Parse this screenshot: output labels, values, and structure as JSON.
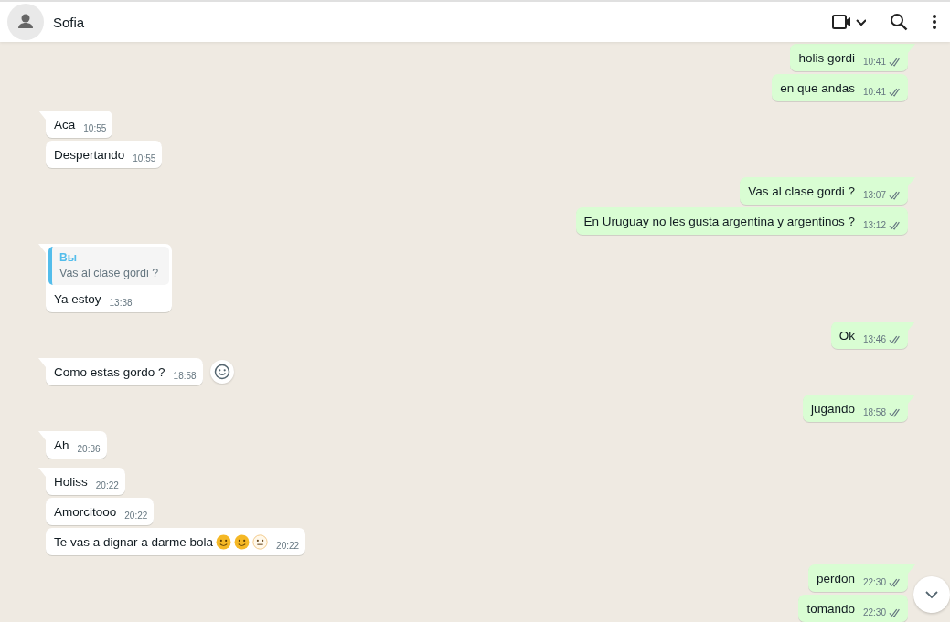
{
  "contact": {
    "name": "Sofia"
  },
  "messages": [
    {
      "outgoing": true,
      "kind": "text",
      "tail": true,
      "text": "holis gordi",
      "time": "10:41",
      "delivered": true
    },
    {
      "outgoing": true,
      "kind": "text",
      "tail": false,
      "text": "en que andas",
      "time": "10:41",
      "delivered": true
    },
    {
      "outgoing": false,
      "kind": "text",
      "tail": true,
      "text": "Aca",
      "time": "10:55"
    },
    {
      "outgoing": false,
      "kind": "text",
      "tail": false,
      "text": "Despertando",
      "time": "10:55"
    },
    {
      "outgoing": true,
      "kind": "text",
      "tail": true,
      "text": "Vas al clase gordi ?",
      "time": "13:07",
      "delivered": true
    },
    {
      "outgoing": true,
      "kind": "text",
      "tail": false,
      "text": "En Uruguay no les gusta argentina y argentinos ?",
      "time": "13:12",
      "delivered": true
    },
    {
      "outgoing": false,
      "kind": "reply",
      "tail": true,
      "quote": {
        "author": "Вы",
        "text": "Vas al clase gordi ?"
      },
      "text": "Ya estoy",
      "time": "13:38"
    },
    {
      "outgoing": true,
      "kind": "text",
      "tail": true,
      "text": "Ok",
      "time": "13:46",
      "delivered": true
    },
    {
      "outgoing": false,
      "kind": "text",
      "tail": true,
      "hover": true,
      "text": "Como estas gordo ?",
      "time": "18:58"
    },
    {
      "outgoing": true,
      "kind": "text",
      "tail": true,
      "text": "jugando",
      "time": "18:58",
      "delivered": true
    },
    {
      "outgoing": false,
      "kind": "text",
      "tail": true,
      "text": "Ah",
      "time": "20:36"
    },
    {
      "outgoing": false,
      "kind": "text",
      "tail": true,
      "text": "Holiss",
      "time": "20:22"
    },
    {
      "outgoing": false,
      "kind": "text",
      "tail": false,
      "text": "Amorcitooo",
      "time": "20:22"
    },
    {
      "outgoing": false,
      "kind": "emoji",
      "tail": false,
      "text": "Te vas a dignar a darme bola",
      "time": "20:22"
    },
    {
      "outgoing": true,
      "kind": "text",
      "tail": true,
      "text": "perdon",
      "time": "22:30",
      "delivered": true
    },
    {
      "outgoing": true,
      "kind": "text",
      "tail": false,
      "text": "tomando",
      "time": "22:30",
      "delivered": true
    }
  ]
}
